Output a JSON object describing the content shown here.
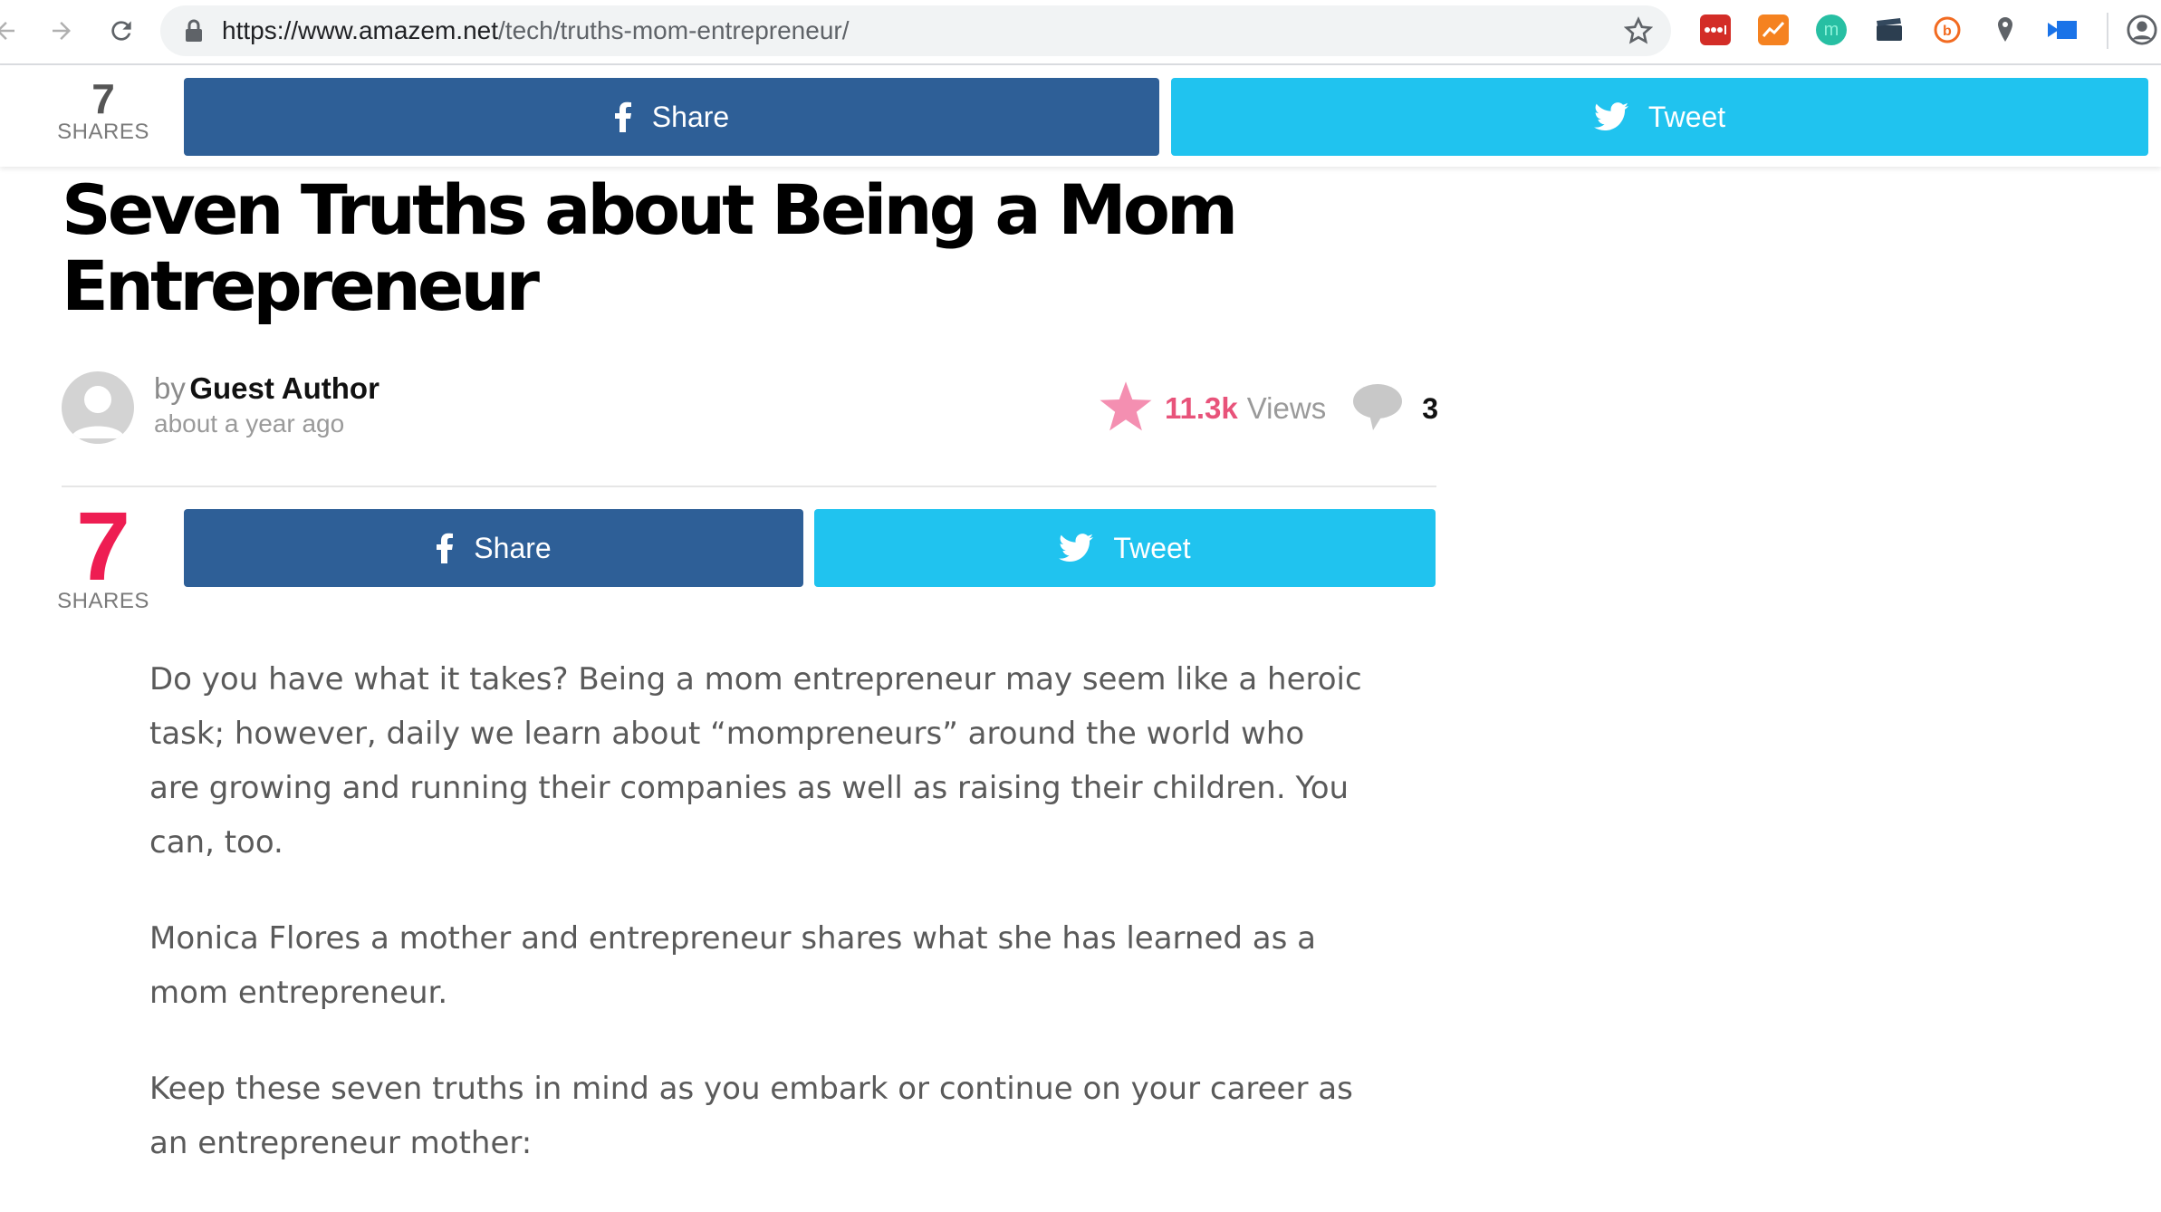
{
  "browser": {
    "url_domain": "https://www.amazem.net",
    "url_path": "/tech/truths-mom-entrepreneur/",
    "extensions": [
      "lastpass-icon",
      "analytics-icon",
      "m-extension-icon",
      "clapper-icon",
      "b-extension-icon",
      "map-pin-icon",
      "screen-share-icon"
    ],
    "extension_labels": {
      "m": "m",
      "b": "b"
    }
  },
  "sticky_bar": {
    "share_count": "7",
    "shares_label": "SHARES",
    "facebook_label": "Share",
    "twitter_label": "Tweet"
  },
  "article": {
    "title": "Seven Truths about Being a Mom Entrepreneur",
    "by_prefix": "by",
    "author": "Guest Author",
    "date": "about a year ago",
    "views_count": "11.3k",
    "views_label": "Views",
    "comment_count": "3",
    "share_count": "7",
    "shares_label": "SHARES",
    "facebook_label": "Share",
    "twitter_label": "Tweet",
    "paragraphs": [
      "Do you have what it takes? Being a mom entrepreneur may seem like a heroic task; however, daily we learn about “mompreneurs” around the world who are growing and running their companies as well as raising their children. You can, too.",
      "Monica Flores a mother and entrepreneur shares what she has learned as a mom entrepreneur.",
      "Keep these seven truths in mind as you embark or continue on your career as an entrepreneur mother:"
    ]
  },
  "colors": {
    "facebook": "#2e5f97",
    "twitter": "#20c3ef",
    "accent_pink": "#e8537a",
    "share_count_red": "#ee1d52"
  }
}
